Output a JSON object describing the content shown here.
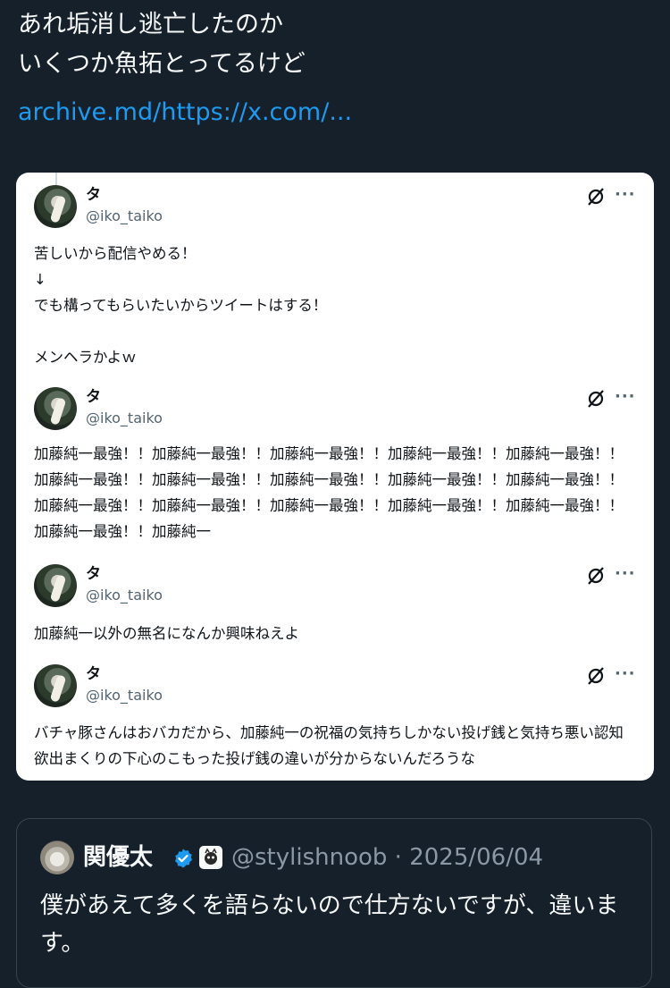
{
  "post": {
    "lines": [
      "あれ垢消し逃亡したのか",
      "いくつか魚拓とってるけど"
    ],
    "link": "archive.md/https://x.com/..."
  },
  "screenshot": {
    "tweets": [
      {
        "name": "タ",
        "handle": "@iko_taiko",
        "body": [
          "苦しいから配信やめる！",
          "↓",
          "でも構ってもらいたいからツイートはする！",
          "",
          "メンヘラかよｗ"
        ]
      },
      {
        "name": "タ",
        "handle": "@iko_taiko",
        "body": [
          "加藤純一最強！！加藤純一最強！！加藤純一最強！！加藤純一最強！！加藤純一最強！！加藤純一最強！！加藤純一最強！！加藤純一最強！！加藤純一最強！！加藤純一最強！！加藤純一最強！！加藤純一最強！！加藤純一最強！！加藤純一最強！！加藤純一最強！！加藤純一最強！！加藤純一"
        ]
      },
      {
        "name": "タ",
        "handle": "@iko_taiko",
        "body": [
          "加藤純一以外の無名になんか興味ねえよ"
        ]
      },
      {
        "name": "タ",
        "handle": "@iko_taiko",
        "body": [
          "バチャ豚さんはおバカだから、加藤純一の祝福の気持ちしかない投げ銭と気持ち悪い認知欲出まくりの下心のこもった投げ銭の違いが分からないんだろうな"
        ]
      }
    ]
  },
  "quote": {
    "name": "関優太",
    "handle_date": "@stylishnoob · 2025/06/04",
    "body": "僕があえて多くを語らないので仕方ないですが、違います。"
  },
  "icons": {
    "grok": "grok-icon",
    "more": "more-icon",
    "verified": "verified-badge-icon",
    "affiliate": "affiliate-badge-icon"
  },
  "colors": {
    "background": "#15202b",
    "link": "#1d9bf0",
    "verified": "#1d9bf0"
  }
}
